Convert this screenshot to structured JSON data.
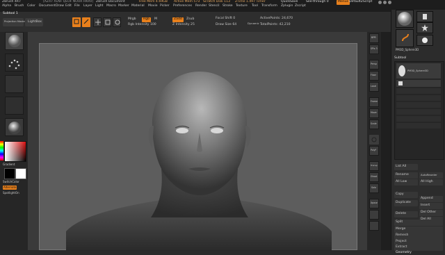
{
  "title_bar": {
    "app_name": "ZBrush 4R7",
    "doc_info": "[AZ47 XLNF QEOF NOUR HKRV]",
    "doc_name": "ZBrush Document",
    "free_mem": "Free Mem 4.69GB",
    "active_mem": "Active Mem 573",
    "scratch_disk": "Scratch Disk 113",
    "ztime": "ZTime 1.497 Timer",
    "quicksave": "QuickSave",
    "see_through": "See-through 0",
    "menus_button": "Menus",
    "default_zscript": "DefaultZScript"
  },
  "menu_items": [
    "Alpha",
    "Brush",
    "Color",
    "Document",
    "Draw",
    "Edit",
    "File",
    "Layer",
    "Light",
    "Macro",
    "Marker",
    "Material",
    "Movie",
    "Picker",
    "Preferences",
    "Render",
    "Stencil",
    "Stroke",
    "Texture",
    "Tool",
    "Transform",
    "Zplugin",
    "Zscript"
  ],
  "tool_title": "Subtool 1",
  "toolbar": {
    "projection_master": "Projection Master",
    "lightbox": "LightBox",
    "edit_label": "Edit",
    "draw_label": "Draw",
    "move_label": "Move",
    "scale_label": "Scale",
    "rotate_label": "Rotate",
    "mrgb": "Mrgb",
    "rgb": "Rgb",
    "m": "M",
    "rgb_intensity": "Rgb Intensity 100",
    "zadd": "Zadd",
    "zsub": "Zsub",
    "zcut": "Zcut",
    "z_intensity": "Z Intensity 25",
    "focal_shift": "Focal Shift 0",
    "draw_size": "Draw Size 64",
    "dynamic": "Dynamic",
    "active_points": "ActivePoints: 24,670",
    "total_points": "TotalPoints: 42,210"
  },
  "left_tray": {
    "gradient": "Gradient",
    "switch_color": "SwitchColor",
    "alternate": "Alternate",
    "spotlight": "SpotlightOn"
  },
  "right_shelf": {
    "bpr": "BPR",
    "spix": "SPix 3",
    "persp": "Persp",
    "floor": "Floor",
    "local": "Local",
    "frame": "Frame",
    "move": "Move",
    "scale": "Scale",
    "rotate": "Rotate",
    "polyf": "PolyF",
    "transp": "Transp",
    "ghost": "Ghost",
    "solo": "Solo",
    "xpose": "Xpose"
  },
  "side_panel": {
    "tool_name": "PM3D_Sphere3D",
    "subtool_header": "Subtool",
    "list_all": "List All",
    "rename": "Rename",
    "auto_reorder": "AutoReorder",
    "all_low": "All Low",
    "all_high": "All High",
    "copy": "Copy",
    "duplicate": "Duplicate",
    "append": "Append",
    "insert": "Insert",
    "delete": "Delete",
    "del_other": "Del Other",
    "del_all": "Del All",
    "split": "Split",
    "merge": "Merge",
    "remesh": "Remesh",
    "project": "Project",
    "extract": "Extract",
    "geometry": "Geometry"
  },
  "colors": {
    "accent": "#e8801c",
    "background": "#2b2b2b",
    "canvas": "#5d5d5d"
  }
}
